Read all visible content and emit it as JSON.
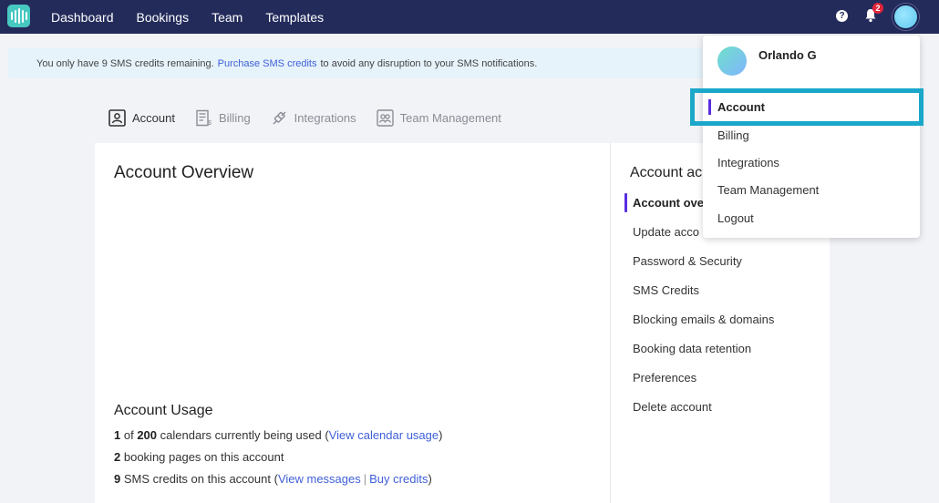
{
  "nav": {
    "items": [
      "Dashboard",
      "Bookings",
      "Team",
      "Templates"
    ],
    "notification_count": "2",
    "help_label": "?"
  },
  "banner": {
    "text_before": "You only have 9 SMS credits remaining.",
    "link": "Purchase SMS credits",
    "text_after": "to avoid any disruption to your SMS notifications."
  },
  "tabs": [
    {
      "label": "Account",
      "icon": "account-icon",
      "active": true
    },
    {
      "label": "Billing",
      "icon": "billing-icon",
      "active": false
    },
    {
      "label": "Integrations",
      "icon": "integrations-icon",
      "active": false
    },
    {
      "label": "Team Management",
      "icon": "team-icon",
      "active": false
    }
  ],
  "main": {
    "title": "Account Overview",
    "usage_title": "Account Usage",
    "usage": {
      "calendars_used": "1",
      "calendars_of": "of",
      "calendars_total": "200",
      "calendars_text": "calendars currently being used (",
      "calendars_link": "View calendar usage",
      "calendars_close": ")",
      "booking_pages": "2",
      "booking_pages_text": "booking pages on this account",
      "sms_credits": "9",
      "sms_text": "SMS credits on this account (",
      "sms_link1": "View messages",
      "sms_sep": "|",
      "sms_link2": "Buy credits",
      "sms_close": ")"
    }
  },
  "side": {
    "title": "Account ac",
    "items": [
      "Account ove",
      "Update acco",
      "Password & Security",
      "SMS Credits",
      "Blocking emails & domains",
      "Booking data retention",
      "Preferences",
      "Delete account"
    ]
  },
  "dropdown": {
    "user_name": "Orlando G",
    "items": [
      "Account",
      "Billing",
      "Integrations",
      "Team Management",
      "Logout"
    ]
  },
  "colors": {
    "nav_bg": "#232b5b",
    "accent": "#5a2de0",
    "link": "#3f5fd8",
    "highlight": "#1aa7c9",
    "badge": "#e0253a"
  }
}
